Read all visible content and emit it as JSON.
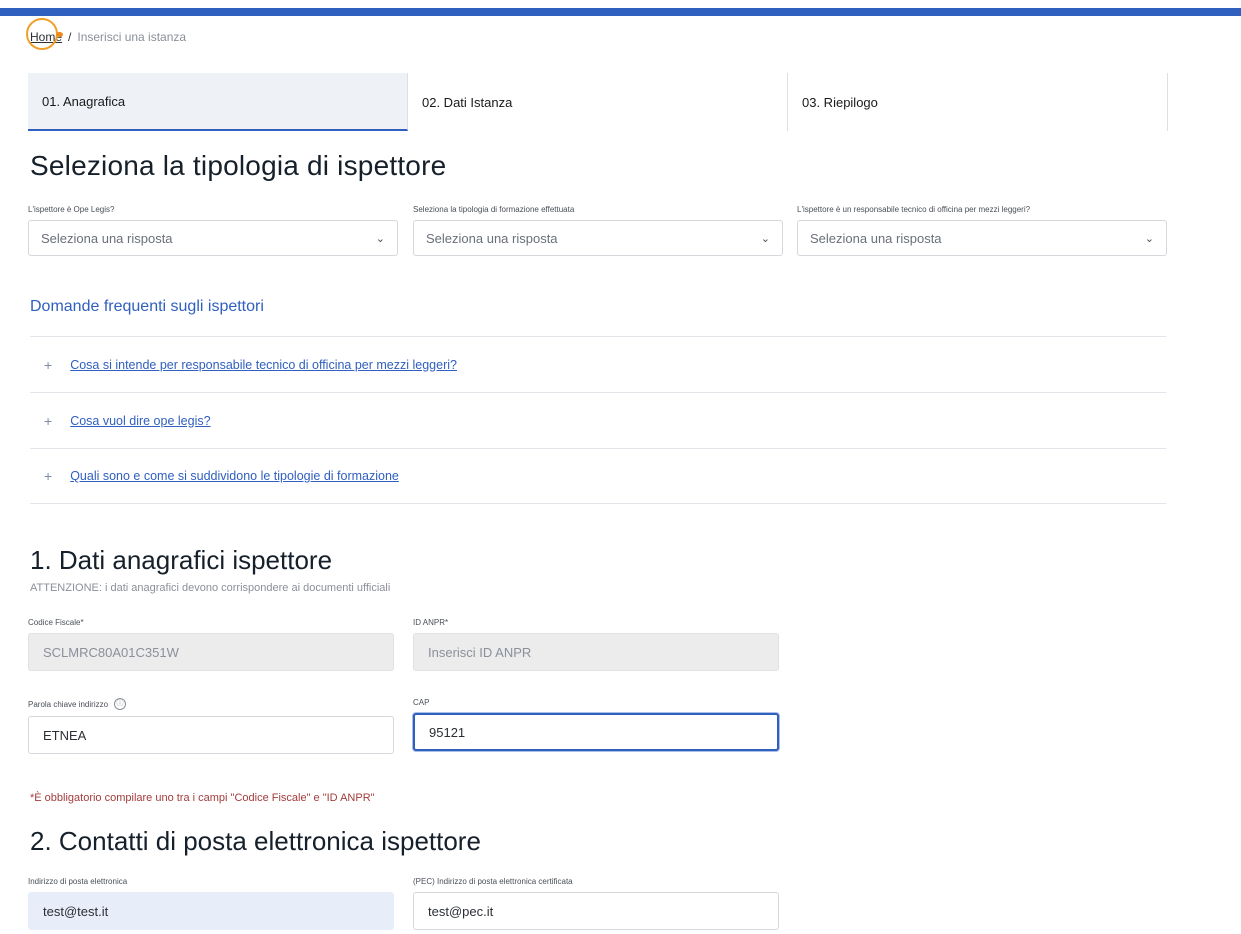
{
  "breadcrumb": {
    "home": "Home",
    "separator": "/",
    "current": "Inserisci una istanza"
  },
  "steps": [
    {
      "label": "01. Anagrafica"
    },
    {
      "label": "02. Dati Istanza"
    },
    {
      "label": "03. Riepilogo"
    }
  ],
  "section_tipologia": {
    "title": "Seleziona la tipologia di ispettore",
    "selects": [
      {
        "label": "L'ispettore è Ope Legis?",
        "value": "Seleziona una risposta"
      },
      {
        "label": "Seleziona la tipologia di formazione effettuata",
        "value": "Seleziona una risposta"
      },
      {
        "label": "L'ispettore è un responsabile tecnico di officina per mezzi leggeri?",
        "value": "Seleziona una risposta"
      }
    ]
  },
  "faq": {
    "title": "Domande frequenti sugli ispettori",
    "items": [
      {
        "icon": "+",
        "label": "Cosa si intende per responsabile tecnico di officina per mezzi leggeri?"
      },
      {
        "icon": "+",
        "label": "Cosa vuol dire ope legis?"
      },
      {
        "icon": "+",
        "label": "Quali sono e come si suddividono le tipologie di formazione"
      }
    ]
  },
  "section1": {
    "title": "1. Dati anagrafici ispettore",
    "warning": "ATTENZIONE: i dati anagrafici devono corrispondere ai documenti ufficiali",
    "codice_fiscale": {
      "label": "Codice Fiscale*",
      "value": "SCLMRC80A01C351W"
    },
    "id_anpr": {
      "label": "ID ANPR*",
      "placeholder": "Inserisci ID ANPR"
    },
    "parola_chiave": {
      "label": "Parola chiave indirizzo",
      "info_icon": "ⓘ",
      "value": "ETNEA"
    },
    "cap": {
      "label": "CAP",
      "value": "95121"
    },
    "mandatory_note": "*È obbligatorio compilare uno tra i campi \"Codice Fiscale\" e \"ID ANPR\""
  },
  "section2": {
    "title": "2. Contatti di posta elettronica ispettore",
    "email": {
      "label": "Indirizzo di posta elettronica",
      "value": "test@test.it"
    },
    "pec": {
      "label": "(PEC) Indirizzo di posta elettronica certificata",
      "value": "test@pec.it"
    }
  },
  "colors": {
    "accent": "#2f5fbf",
    "error": "#a33c3c",
    "cursor": "#f0a02a"
  }
}
